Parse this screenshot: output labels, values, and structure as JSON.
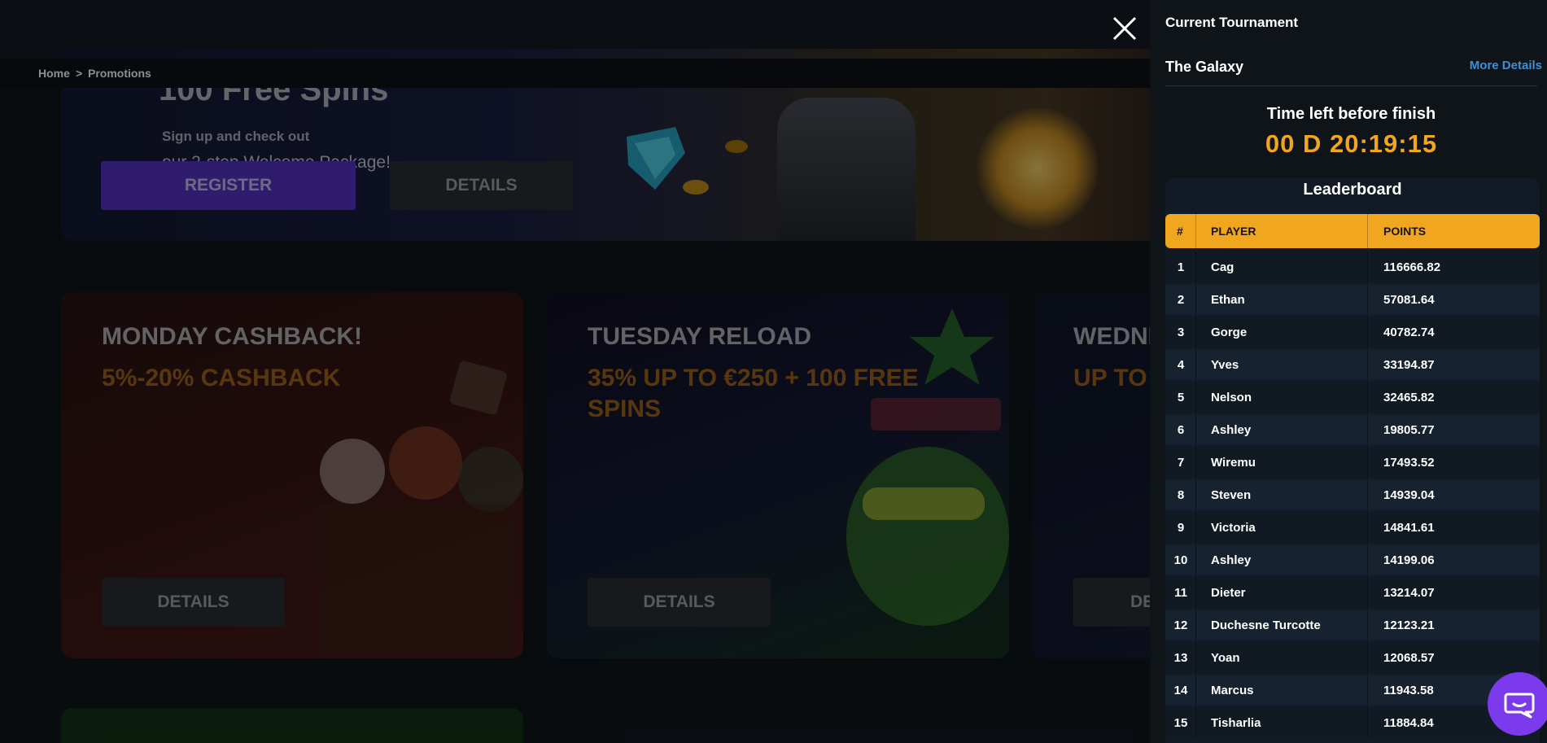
{
  "breadcrumb": {
    "home": "Home",
    "separator": ">",
    "current": "Promotions"
  },
  "hero": {
    "title": "100 Free Spins",
    "line1": "Sign up and check out",
    "line2": "our 2-step Welcome Package!",
    "register_label": "REGISTER",
    "details_label": "DETAILS"
  },
  "promos": [
    {
      "title": "MONDAY CASHBACK!",
      "subtitle": "5%-20% CASHBACK",
      "button": "DETAILS"
    },
    {
      "title": "TUESDAY RELOAD",
      "subtitle": "35% UP TO €250 + 100 FREE SPINS",
      "button": "DETAILS"
    },
    {
      "title": "WEDNE",
      "subtitle": "UP TO",
      "button": "DE"
    }
  ],
  "panel": {
    "header": "Current Tournament",
    "tournament_name": "The Galaxy",
    "more_details": "More Details",
    "time_label": "Time left before finish",
    "timer": "00 D 20:19:15",
    "leaderboard_title": "Leaderboard",
    "columns": {
      "rank": "#",
      "player": "PLAYER",
      "points": "POINTS"
    },
    "rows": [
      {
        "rank": "1",
        "player": "Cag",
        "points": "116666.82"
      },
      {
        "rank": "2",
        "player": "Ethan",
        "points": "57081.64"
      },
      {
        "rank": "3",
        "player": "Gorge",
        "points": "40782.74"
      },
      {
        "rank": "4",
        "player": "Yves",
        "points": "33194.87"
      },
      {
        "rank": "5",
        "player": "Nelson",
        "points": "32465.82"
      },
      {
        "rank": "6",
        "player": "Ashley",
        "points": "19805.77"
      },
      {
        "rank": "7",
        "player": "Wiremu",
        "points": "17493.52"
      },
      {
        "rank": "8",
        "player": "Steven",
        "points": "14939.04"
      },
      {
        "rank": "9",
        "player": "Victoria",
        "points": "14841.61"
      },
      {
        "rank": "10",
        "player": "Ashley",
        "points": "14199.06"
      },
      {
        "rank": "11",
        "player": "Dieter",
        "points": "13214.07"
      },
      {
        "rank": "12",
        "player": "Duchesne Turcotte",
        "points": "12123.21"
      },
      {
        "rank": "13",
        "player": "Yoan",
        "points": "12068.57"
      },
      {
        "rank": "14",
        "player": "Marcus",
        "points": "11943.58"
      },
      {
        "rank": "15",
        "player": "Tisharlia",
        "points": "11884.84"
      }
    ]
  },
  "icons": {
    "close": "close-icon",
    "chat": "chat-icon"
  },
  "colors": {
    "accent": "#f0a61f",
    "link": "#3d8fd6",
    "register": "#5634c7",
    "chat": "#7c3aed"
  }
}
